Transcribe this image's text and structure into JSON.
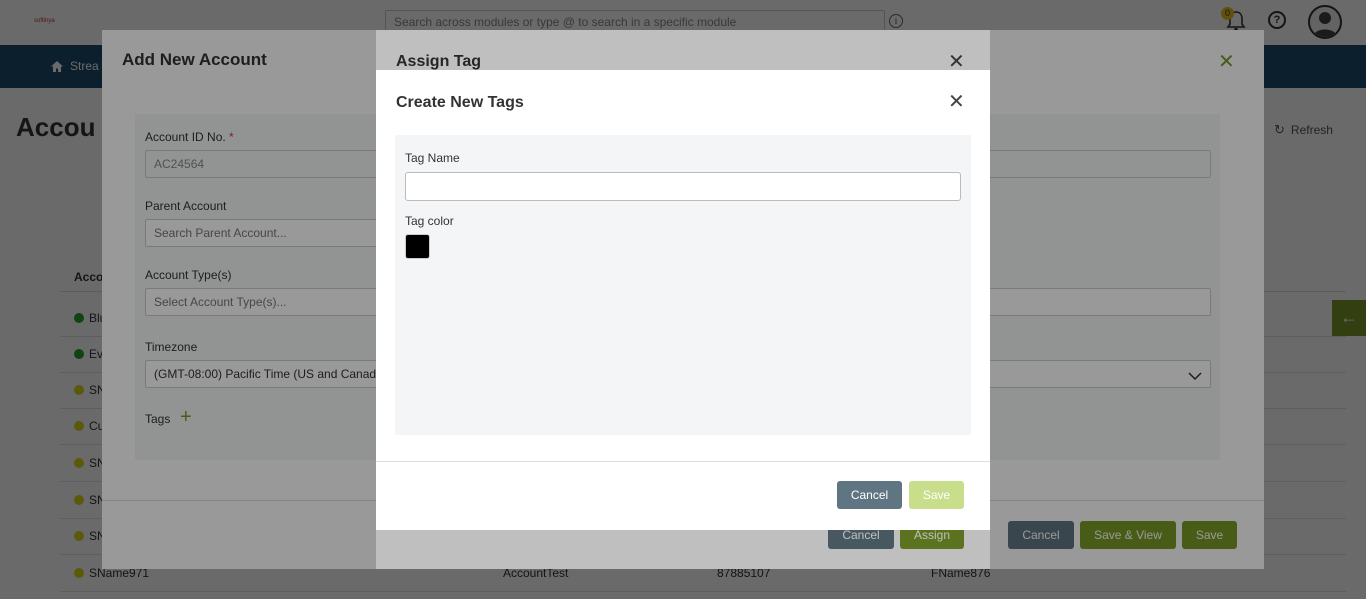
{
  "topbar": {
    "logo_text": "softinya",
    "search_placeholder": "Search across modules or type @ to search in a specific module",
    "notification_count": "0"
  },
  "nav": {
    "item_label": "Strea"
  },
  "page": {
    "title": "Accou",
    "refresh_label": "Refresh"
  },
  "grid": {
    "header_label": "Acco",
    "rows": [
      {
        "name": "Blu",
        "status_color": "#2aa02a"
      },
      {
        "name": "Ev",
        "status_color": "#2aa02a"
      },
      {
        "name": "SN",
        "status_color": "#d8d81a"
      },
      {
        "name": "Cu",
        "status_color": "#d8d81a"
      },
      {
        "name": "SN",
        "status_color": "#d8d81a"
      },
      {
        "name": "SN",
        "status_color": "#d8d81a"
      },
      {
        "name": "SN",
        "status_color": "#d8d81a"
      },
      {
        "name": "SName971",
        "status_color": "#d8d81a",
        "col2": "AccountTest",
        "col3": "87885107",
        "col4": "FName876"
      }
    ]
  },
  "account_modal": {
    "title": "Add New Account",
    "account_id_label": "Account ID No.",
    "account_id_required": "*",
    "account_id_value": "AC24564",
    "parent_label": "Parent Account",
    "parent_placeholder": "Search Parent Account...",
    "type_label": "Account Type(s)",
    "type_placeholder": "Select Account Type(s)...",
    "timezone_label": "Timezone",
    "timezone_value": "(GMT-08:00) Pacific Time (US and Canada)",
    "tags_label": "Tags",
    "cancel_label": "Cancel",
    "save_view_label": "Save & View",
    "save_label": "Save"
  },
  "assign_modal": {
    "title": "Assign Tag",
    "cancel_label": "Cancel",
    "assign_label": "Assign"
  },
  "create_modal": {
    "title": "Create New Tags",
    "tag_name_label": "Tag Name",
    "tag_name_value": "",
    "tag_color_label": "Tag color",
    "tag_color": "#000000",
    "cancel_label": "Cancel",
    "save_label": "Save"
  },
  "colors": {
    "accent_green": "#7a9a2a",
    "nav_blue": "#1f4d6b",
    "cancel_grey": "#5f7682",
    "save_disabled": "#c8de8a"
  }
}
